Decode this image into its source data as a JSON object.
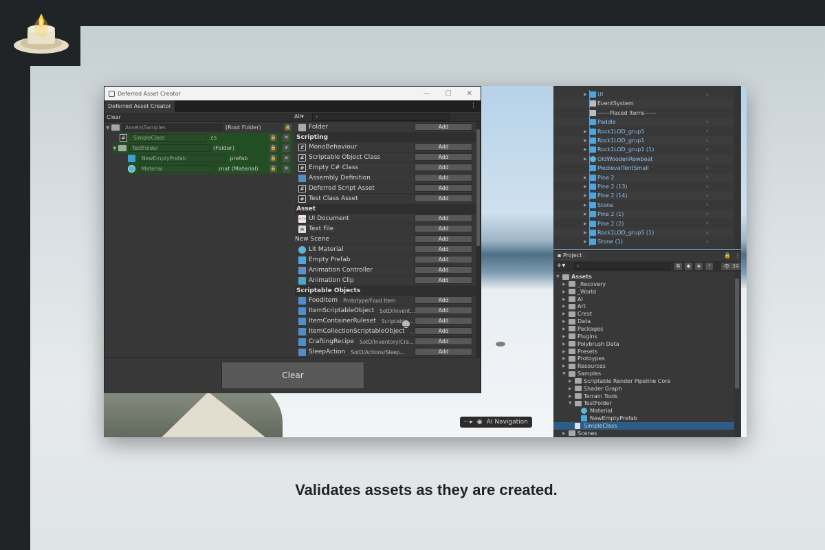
{
  "caption": "Validates assets as they are created.",
  "scene": {
    "ai_navigation_label": "AI Navigation"
  },
  "window": {
    "title": "Deferred Asset Creator",
    "tab_label": "Deferred Asset Creator",
    "clear_link": "Clear",
    "filter_label": "All",
    "search_placeholder": "",
    "clear_button": "Clear",
    "tree": [
      {
        "name": "Assets\\Samples",
        "ext": "(Root Folder)"
      },
      {
        "name": "SimpleClass",
        "ext": ".cs"
      },
      {
        "name": "TestFolder",
        "ext": "(Folder)"
      },
      {
        "name": "NewEmptyPrefab",
        "ext": ".prefab"
      },
      {
        "name": "Material",
        "ext": ".mat (Material)"
      }
    ],
    "add_label": "Add",
    "folder_item": "Folder",
    "sections": {
      "scripting": "Scripting",
      "asset": "Asset",
      "scriptable_objects": "Scriptable Objects"
    },
    "scripting_items": [
      "MonoBehaviour",
      "Scriptable Object Class",
      "Empty C# Class",
      "Assembly Definition",
      "Deferred Script Asset",
      "Test Class Asset"
    ],
    "asset_items": [
      "UI Document",
      "Text File",
      "New Scene",
      "Lit Material",
      "Empty Prefab",
      "Animation Controller",
      "Animation Clip"
    ],
    "so_items": [
      {
        "name": "FoodItem",
        "path": "Prototype/Food Item"
      },
      {
        "name": "ItemScriptableObject",
        "path": "SotD/Invent..."
      },
      {
        "name": "ItemContainerRuleset",
        "path": "Scriptable ..."
      },
      {
        "name": "ItemCollectionScriptableObject",
        "path": "..."
      },
      {
        "name": "CraftingRecipe",
        "path": "SotD/Inventory/Cra..."
      },
      {
        "name": "SleepAction",
        "path": "SotD/Actions/Sleep..."
      }
    ]
  },
  "hierarchy": {
    "items": [
      {
        "name": "UI",
        "icon": "cube",
        "color": "blue",
        "expand": true
      },
      {
        "name": "EventSystem",
        "icon": "cube-white",
        "color": "white",
        "expand": false
      },
      {
        "name": "------Placed Items------",
        "icon": "cube-white",
        "color": "white",
        "expand": false
      },
      {
        "name": "Paddle",
        "icon": "cube",
        "color": "blue",
        "expand": false
      },
      {
        "name": "Rock1LOD_grup5",
        "icon": "cube",
        "color": "blue",
        "expand": true
      },
      {
        "name": "Rock1LOD_grup1",
        "icon": "cube",
        "color": "blue",
        "expand": true
      },
      {
        "name": "Rock1LOD_grup1 (1)",
        "icon": "cube",
        "color": "blue",
        "expand": true
      },
      {
        "name": "OldWoodenRowboat",
        "icon": "sphere",
        "color": "blue",
        "expand": true
      },
      {
        "name": "MedievalTentSmall",
        "icon": "cube",
        "color": "blue",
        "expand": false
      },
      {
        "name": "Pine 2",
        "icon": "cube",
        "color": "blue",
        "expand": true
      },
      {
        "name": "Pine 2 (13)",
        "icon": "cube",
        "color": "blue",
        "expand": true
      },
      {
        "name": "Pine 2 (14)",
        "icon": "cube",
        "color": "blue",
        "expand": true
      },
      {
        "name": "Stone",
        "icon": "cube",
        "color": "blue",
        "expand": true
      },
      {
        "name": "Pine 2 (1)",
        "icon": "cube",
        "color": "blue",
        "expand": true
      },
      {
        "name": "Pine 2 (2)",
        "icon": "cube",
        "color": "blue",
        "expand": true
      },
      {
        "name": "Rock1LOD_grup5 (1)",
        "icon": "cube",
        "color": "blue",
        "expand": true
      },
      {
        "name": "Stone (1)",
        "icon": "cube",
        "color": "blue",
        "expand": true
      }
    ]
  },
  "project": {
    "tab_label": "Project",
    "count": "39",
    "items": [
      {
        "name": "Assets",
        "depth": 0,
        "arrow": "open",
        "icon": "folder",
        "bold": true
      },
      {
        "name": "_Recovery",
        "depth": 1,
        "arrow": "closed",
        "icon": "folder"
      },
      {
        "name": "_World",
        "depth": 1,
        "arrow": "closed",
        "icon": "folder"
      },
      {
        "name": "AI",
        "depth": 1,
        "arrow": "closed",
        "icon": "folder"
      },
      {
        "name": "Art",
        "depth": 1,
        "arrow": "closed",
        "icon": "folder"
      },
      {
        "name": "Crest",
        "depth": 1,
        "arrow": "closed",
        "icon": "folder"
      },
      {
        "name": "Data",
        "depth": 1,
        "arrow": "closed",
        "icon": "folder"
      },
      {
        "name": "Packages",
        "depth": 1,
        "arrow": "closed",
        "icon": "folder"
      },
      {
        "name": "Plugins",
        "depth": 1,
        "arrow": "closed",
        "icon": "folder"
      },
      {
        "name": "Polybrush Data",
        "depth": 1,
        "arrow": "closed",
        "icon": "folder"
      },
      {
        "name": "Presets",
        "depth": 1,
        "arrow": "closed",
        "icon": "folder"
      },
      {
        "name": "Protoypes",
        "depth": 1,
        "arrow": "closed",
        "icon": "folder"
      },
      {
        "name": "Resources",
        "depth": 1,
        "arrow": "closed",
        "icon": "folder"
      },
      {
        "name": "Samples",
        "depth": 1,
        "arrow": "open",
        "icon": "folder"
      },
      {
        "name": "Scriptable Render Pipeline Core",
        "depth": 2,
        "arrow": "closed",
        "icon": "folder"
      },
      {
        "name": "Shader Graph",
        "depth": 2,
        "arrow": "closed",
        "icon": "folder"
      },
      {
        "name": "Terrain Tools",
        "depth": 2,
        "arrow": "closed",
        "icon": "folder"
      },
      {
        "name": "TestFolder",
        "depth": 2,
        "arrow": "open",
        "icon": "folder"
      },
      {
        "name": "Material",
        "depth": 3,
        "arrow": "",
        "icon": "material"
      },
      {
        "name": "NewEmptyPrefab",
        "depth": 3,
        "arrow": "",
        "icon": "prefab"
      },
      {
        "name": "SimpleClass",
        "depth": 2,
        "arrow": "",
        "icon": "cs",
        "selected": true
      },
      {
        "name": "Scenes",
        "depth": 1,
        "arrow": "closed",
        "icon": "folder"
      }
    ]
  },
  "colors": {
    "valid_row": "#234d23",
    "selection": "#2c5d87",
    "hierarchy_text": "#8fc0ee"
  }
}
